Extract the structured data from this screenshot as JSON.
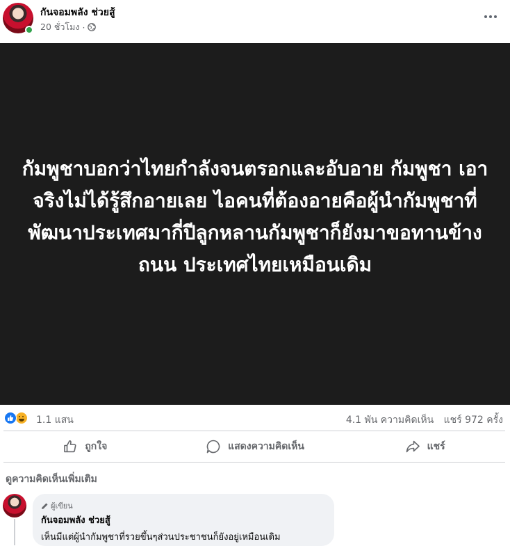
{
  "post": {
    "page_name": "กันจอมพลัง ช่วยสู้",
    "time": "20 ชั่วโมง",
    "separator": "·",
    "image_text": "กัมพูชาบอกว่าไทยกำลังจนตรอกและอับอาย กัมพูชา เอาจริงไม่ได้รู้สึกอายเลย ไอคนที่ต้องอายคือผู้นำกัมพูชาที่พัฒนาประเทศมากี่ปีลูกหลานกัมพูชาก็ยังมาขอทานข้างถนน ประเทศไทยเหมือนเดิม"
  },
  "stats": {
    "reactions": "1.1 แสน",
    "comments": "4.1 พัน ความคิดเห็น",
    "shares": "แชร์ 972 ครั้ง"
  },
  "actions": {
    "like": "ถูกใจ",
    "comment": "แสดงความคิดเห็น",
    "share": "แชร์"
  },
  "comments_section": {
    "more_label": "ดูความคิดเห็นเพิ่มเติม",
    "comment": {
      "badge": "ผู้เขียน",
      "name": "กันจอมพลัง ช่วยสู้",
      "text": "เห็นมีแต่ผู้นำกัมพูชาที่รวยขึ้นๆส่วนประชาชนก็ยังอยู่เหมือนเดิม"
    }
  },
  "colors": {
    "facebook_blue": "#1877f2",
    "secondary_text": "#65676b",
    "image_background": "#1c1c1c",
    "online_green": "#31a24c",
    "comment_bubble": "#f0f2f5"
  },
  "icons": [
    "globe-icon",
    "more-options-icon",
    "like-reaction-icon",
    "haha-reaction-icon",
    "thumbs-up-icon",
    "comment-icon",
    "share-icon",
    "pencil-icon"
  ]
}
